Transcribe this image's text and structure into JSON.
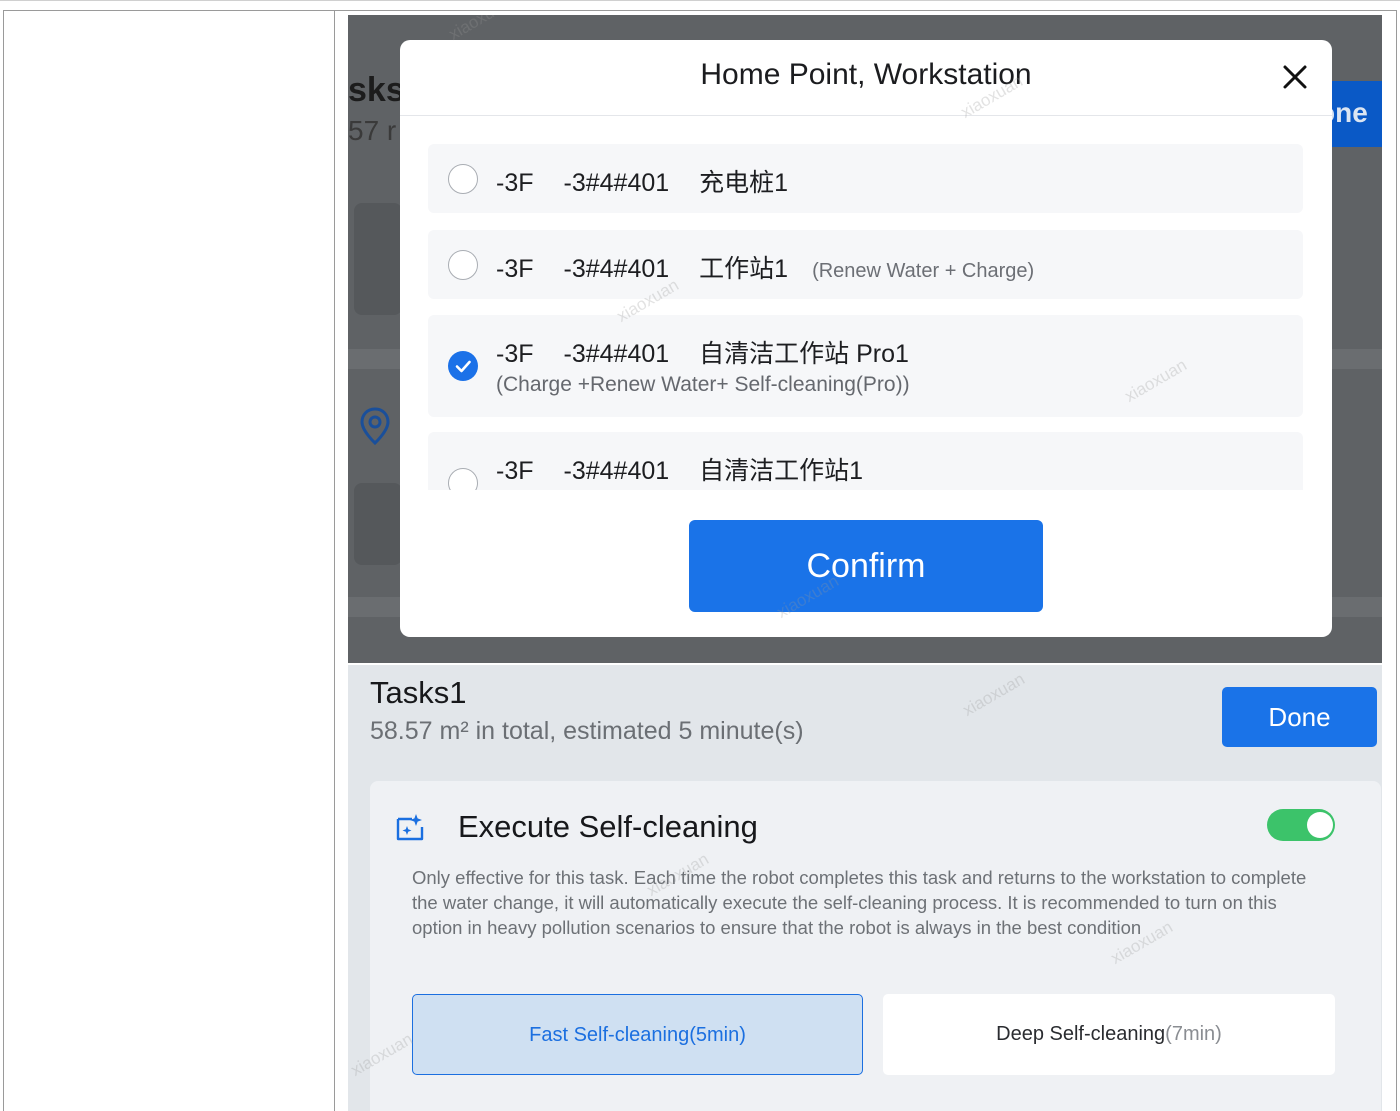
{
  "modal": {
    "title": "Home Point, Workstation",
    "options": [
      {
        "floor": "-3F",
        "code": "-3#4#401",
        "name": "充电桩1",
        "tag": "",
        "sub": "",
        "selected": false
      },
      {
        "floor": "-3F",
        "code": "-3#4#401",
        "name": "工作站1",
        "tag": "(Renew Water + Charge)",
        "sub": "",
        "selected": false
      },
      {
        "floor": "-3F",
        "code": "-3#4#401",
        "name": "自清洁工作站 Pro1",
        "tag": "",
        "sub": "(Charge +Renew Water+ Self-cleaning(Pro))",
        "selected": true
      },
      {
        "floor": "-3F",
        "code": "-3#4#401",
        "name": "自清洁工作站1",
        "tag": "",
        "sub": "",
        "selected": false
      }
    ],
    "confirm_label": "Confirm",
    "background": {
      "title_fragment": "sks",
      "summary_fragment": "57 r",
      "button_fragment": "one"
    }
  },
  "tasks": {
    "title": "Tasks1",
    "summary": "58.57 m² in total, estimated 5 minute(s)",
    "done_label": "Done",
    "self_cleaning": {
      "title": "Execute Self-cleaning",
      "enabled": true,
      "description": "Only effective for this task. Each time the robot completes this task and returns to the workstation to complete the water change, it will automatically execute the self-cleaning process. It is recommended to turn on this option in heavy pollution scenarios to ensure that the robot is always in the best condition",
      "fast_label": "Fast Self-cleaning(5min)",
      "deep_label": "Deep Self-cleaning",
      "deep_duration": "(7min)",
      "selected_mode": "fast"
    }
  },
  "watermark": "xiaoxuan",
  "colors": {
    "accent": "#1a73e8",
    "toggle_on": "#3cc36a",
    "overlay": "#5f6265"
  }
}
